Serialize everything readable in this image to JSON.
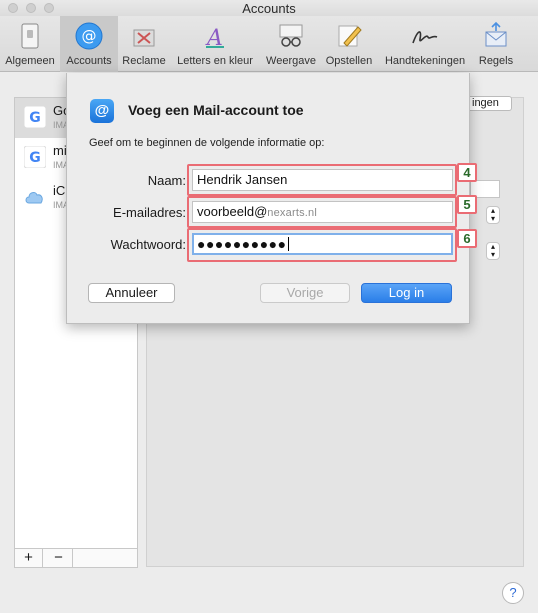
{
  "window": {
    "title": "Accounts"
  },
  "toolbar": {
    "items": [
      {
        "label": "Algemeen"
      },
      {
        "label": "Accounts"
      },
      {
        "label": "Reclame"
      },
      {
        "label": "Letters en kleur"
      },
      {
        "label": "Weergave"
      },
      {
        "label": "Opstellen"
      },
      {
        "label": "Handtekeningen"
      },
      {
        "label": "Regels"
      }
    ]
  },
  "accounts": [
    {
      "name": "Go",
      "sub": "IMA"
    },
    {
      "name": "mi",
      "sub": "IMA"
    },
    {
      "name": "iCl",
      "sub": "IMA"
    }
  ],
  "list_controls": {
    "add": "+",
    "remove": "−"
  },
  "background": {
    "partial_button": "ingen"
  },
  "dialog": {
    "title": "Voeg een Mail-account toe",
    "description": "Geef om te beginnen de volgende informatie op:",
    "name_label": "Naam:",
    "name_value": "Hendrik Jansen",
    "email_label": "E-mailadres:",
    "email_value_prefix": "voorbeeld@",
    "email_value_blurred": "nexarts.nl",
    "password_label": "Wachtwoord:",
    "password_value": "●●●●●●●●●●",
    "cancel_label": "Annuleer",
    "previous_label": "Vorige",
    "login_label": "Log in"
  },
  "annotations": {
    "name_badge": "4",
    "email_badge": "5",
    "password_badge": "6"
  },
  "help": {
    "label": "?"
  },
  "colors": {
    "highlight": "#ea6c74",
    "accent": "#2a7ee8"
  }
}
